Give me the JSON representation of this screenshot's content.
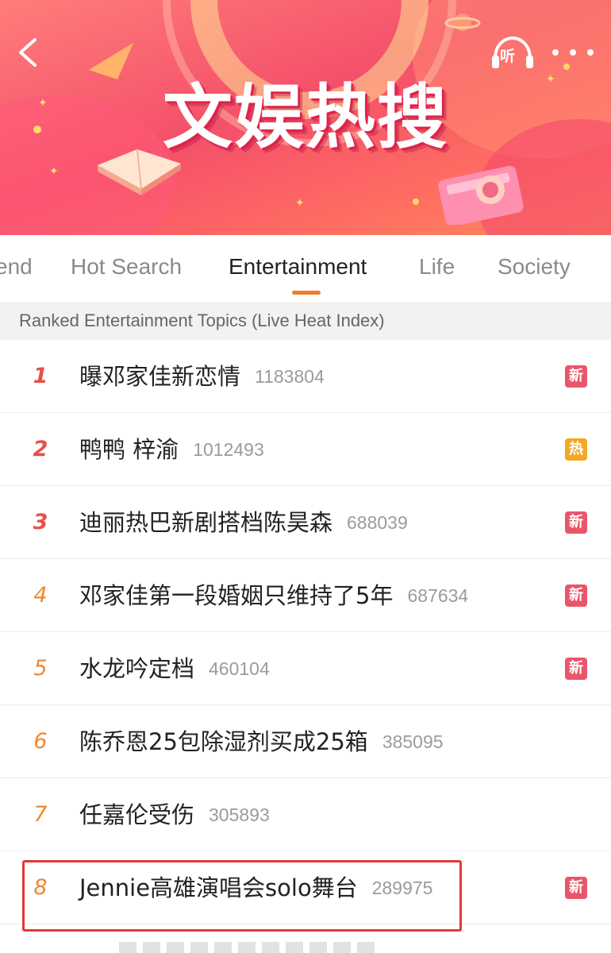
{
  "banner": {
    "title": "文娱热搜",
    "listen_label": "听",
    "colors": {
      "start": "#ff7d7a",
      "mid": "#f4506a",
      "end": "#ff8a5c"
    }
  },
  "tabs": [
    {
      "label": "end",
      "active": false
    },
    {
      "label": "Hot Search",
      "active": false
    },
    {
      "label": "Entertainment",
      "active": true
    },
    {
      "label": "Life",
      "active": false
    },
    {
      "label": "Society",
      "active": false
    }
  ],
  "accent_color": "#f07c2c",
  "section_header": "Ranked Entertainment Topics (Live Heat Index)",
  "topics": [
    {
      "rank": "1",
      "title": "曝邓家佳新恋情",
      "heat": "1183804",
      "badge": "新",
      "badge_type": "new"
    },
    {
      "rank": "2",
      "title": "鸭鸭 梓渝",
      "heat": "1012493",
      "badge": "热",
      "badge_type": "hot"
    },
    {
      "rank": "3",
      "title": "迪丽热巴新剧搭档陈昊森",
      "heat": "688039",
      "badge": "新",
      "badge_type": "new"
    },
    {
      "rank": "4",
      "title": "邓家佳第一段婚姻只维持了5年",
      "heat": "687634",
      "badge": "新",
      "badge_type": "new"
    },
    {
      "rank": "5",
      "title": "水龙吟定档",
      "heat": "460104",
      "badge": "新",
      "badge_type": "new"
    },
    {
      "rank": "6",
      "title": "陈乔恩25包除湿剂买成25箱",
      "heat": "385095",
      "badge": "",
      "badge_type": ""
    },
    {
      "rank": "7",
      "title": "任嘉伦受伤",
      "heat": "305893",
      "badge": "",
      "badge_type": ""
    },
    {
      "rank": "8",
      "title": "Jennie高雄演唱会solo舞台",
      "heat": "289975",
      "badge": "新",
      "badge_type": "new"
    }
  ],
  "badge_colors": {
    "new": "#e9566b",
    "hot": "#f3a826"
  },
  "highlight_color": "#e53935"
}
